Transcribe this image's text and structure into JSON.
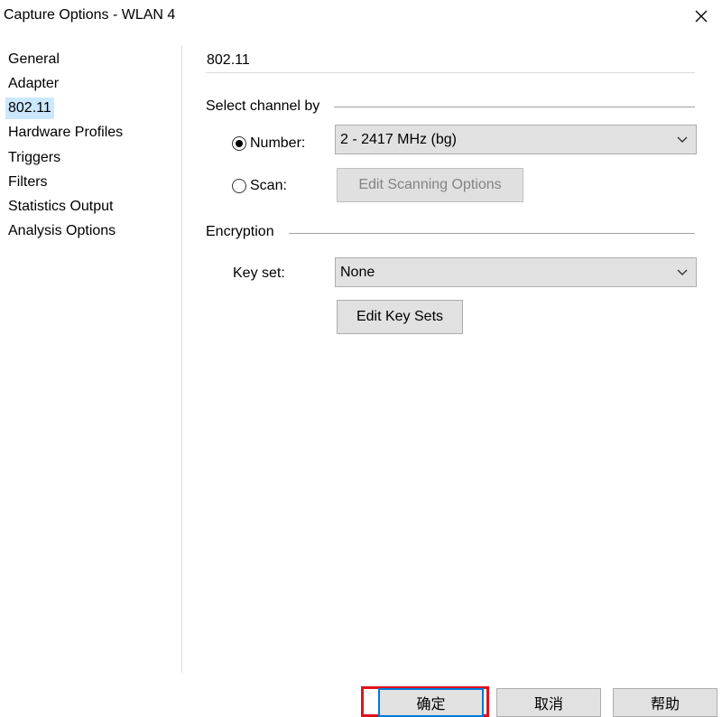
{
  "window": {
    "title": "Capture Options - WLAN 4",
    "close_icon": "close-icon"
  },
  "sidebar": {
    "items": [
      {
        "label": "General",
        "selected": false
      },
      {
        "label": "Adapter",
        "selected": false
      },
      {
        "label": "802.11",
        "selected": true
      },
      {
        "label": "Hardware Profiles",
        "selected": false
      },
      {
        "label": "Triggers",
        "selected": false
      },
      {
        "label": "Filters",
        "selected": false
      },
      {
        "label": "Statistics Output",
        "selected": false
      },
      {
        "label": "Analysis Options",
        "selected": false
      }
    ]
  },
  "panel": {
    "heading": "802.11",
    "channel_group": {
      "label": "Select channel by",
      "number_label": "Number:",
      "number_checked": true,
      "number_value": "2 - 2417 MHz (bg)",
      "scan_label": "Scan:",
      "scan_checked": false,
      "edit_scanning_label": "Edit Scanning Options"
    },
    "encryption_group": {
      "label": "Encryption",
      "keyset_label": "Key set:",
      "keyset_value": "None",
      "edit_keysets_label": "Edit Key Sets"
    }
  },
  "footer": {
    "ok_label": "确定",
    "cancel_label": "取消",
    "help_label": "帮助"
  },
  "colors": {
    "selection": "#cce8ff",
    "highlight_box": "#e0121c",
    "focus_border": "#0078d7"
  }
}
